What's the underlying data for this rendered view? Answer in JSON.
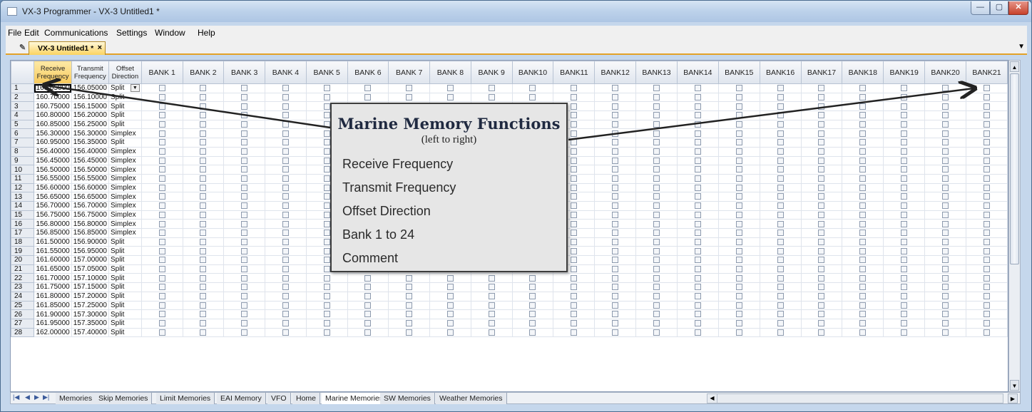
{
  "window": {
    "title": "VX-3 Programmer - VX-3 Untitled1 *",
    "min_glyph": "—",
    "max_glyph": "▢",
    "close_glyph": "✕"
  },
  "menu": [
    "File",
    "Edit",
    "Communications",
    "Settings",
    "Window",
    "Help"
  ],
  "doc_tab": {
    "label": "VX-3 Untitled1 *",
    "close": "×",
    "dropdown": "▼"
  },
  "grid": {
    "headers": {
      "receive": "Receive Frequency",
      "transmit": "Transmit Frequency",
      "offset": "Offset Direction"
    },
    "banks": [
      "BANK 1",
      "BANK 2",
      "BANK 3",
      "BANK 4",
      "BANK 5",
      "BANK 6",
      "BANK 7",
      "BANK 8",
      "BANK 9",
      "BANK10",
      "BANK11",
      "BANK12",
      "BANK13",
      "BANK14",
      "BANK15",
      "BANK16",
      "BANK17",
      "BANK18",
      "BANK19",
      "BANK20",
      "BANK21"
    ],
    "rows": [
      [
        "1",
        "160.65000",
        "156.05000",
        "Split"
      ],
      [
        "2",
        "160.70000",
        "156.10000",
        "Split"
      ],
      [
        "3",
        "160.75000",
        "156.15000",
        "Split"
      ],
      [
        "4",
        "160.80000",
        "156.20000",
        "Split"
      ],
      [
        "5",
        "160.85000",
        "156.25000",
        "Split"
      ],
      [
        "6",
        "156.30000",
        "156.30000",
        "Simplex"
      ],
      [
        "7",
        "160.95000",
        "156.35000",
        "Split"
      ],
      [
        "8",
        "156.40000",
        "156.40000",
        "Simplex"
      ],
      [
        "9",
        "156.45000",
        "156.45000",
        "Simplex"
      ],
      [
        "10",
        "156.50000",
        "156.50000",
        "Simplex"
      ],
      [
        "11",
        "156.55000",
        "156.55000",
        "Simplex"
      ],
      [
        "12",
        "156.60000",
        "156.60000",
        "Simplex"
      ],
      [
        "13",
        "156.65000",
        "156.65000",
        "Simplex"
      ],
      [
        "14",
        "156.70000",
        "156.70000",
        "Simplex"
      ],
      [
        "15",
        "156.75000",
        "156.75000",
        "Simplex"
      ],
      [
        "16",
        "156.80000",
        "156.80000",
        "Simplex"
      ],
      [
        "17",
        "156.85000",
        "156.85000",
        "Simplex"
      ],
      [
        "18",
        "161.50000",
        "156.90000",
        "Split"
      ],
      [
        "19",
        "161.55000",
        "156.95000",
        "Split"
      ],
      [
        "20",
        "161.60000",
        "157.00000",
        "Split"
      ],
      [
        "21",
        "161.65000",
        "157.05000",
        "Split"
      ],
      [
        "22",
        "161.70000",
        "157.10000",
        "Split"
      ],
      [
        "23",
        "161.75000",
        "157.15000",
        "Split"
      ],
      [
        "24",
        "161.80000",
        "157.20000",
        "Split"
      ],
      [
        "25",
        "161.85000",
        "157.25000",
        "Split"
      ],
      [
        "26",
        "161.90000",
        "157.30000",
        "Split"
      ],
      [
        "27",
        "161.95000",
        "157.35000",
        "Split"
      ],
      [
        "28",
        "162.00000",
        "157.40000",
        "Split"
      ]
    ]
  },
  "sheet_tabs": [
    "Memories",
    "Skip Memories",
    "Limit Memories",
    "EAI Memory",
    "VFO",
    "Home",
    "Marine Memories",
    "SW Memories",
    "Weather Memories"
  ],
  "active_sheet": "Marine Memories",
  "callout": {
    "title": "Marine Memory Functions",
    "subtitle": "(left to right)",
    "items": [
      "Receive Frequency",
      "Transmit Frequency",
      "Offset Direction",
      "Bank 1 to 24",
      "Comment"
    ]
  }
}
